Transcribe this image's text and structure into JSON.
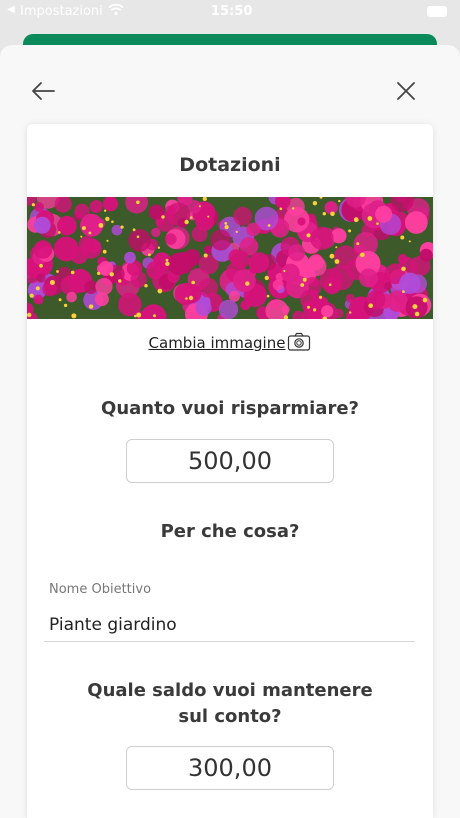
{
  "status_bar": {
    "back_arrow": "◀",
    "app_name": "Impostazioni",
    "time": "15:50",
    "wifi_icon": "wifi-icon",
    "battery_icon": "battery-icon"
  },
  "header": {
    "back_icon": "arrow-left-icon",
    "close_icon": "close-icon"
  },
  "card": {
    "title": "Dotazioni",
    "change_image_label": "Cambia immagine",
    "camera_icon": "camera-icon",
    "amount_question": "Quanto vuoi risparmiare?",
    "amount_value": "500,00",
    "purpose_question": "Per che cosa?",
    "goal_name_label": "Nome Obiettivo",
    "goal_name_value": "Piante giardino",
    "balance_question_line1": "Quale saldo vuoi mantenere",
    "balance_question_line2": "sul conto?",
    "balance_value": "300,00"
  },
  "colors": {
    "accent_green": "#0a8a5a",
    "flower_magenta": "#d6127a",
    "flower_violet": "#b04bd8"
  }
}
